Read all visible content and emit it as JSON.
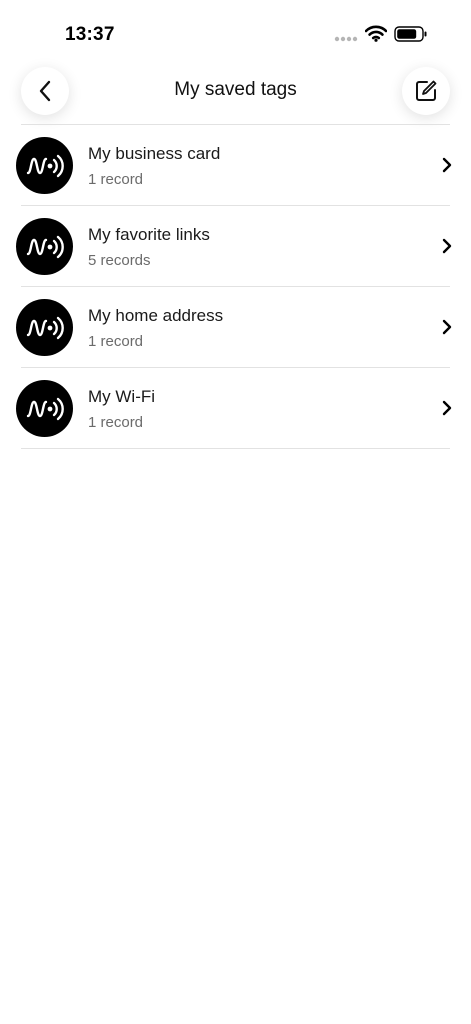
{
  "status_bar": {
    "time": "13:37",
    "icons": [
      "signal-dots-icon",
      "wifi-icon",
      "battery-icon"
    ]
  },
  "header": {
    "title": "My saved tags",
    "back_icon": "chevron-left-icon",
    "edit_icon": "compose-icon"
  },
  "tags": [
    {
      "title": "My business card",
      "count": "1 record"
    },
    {
      "title": "My favorite links",
      "count": "5 records"
    },
    {
      "title": "My home address",
      "count": "1 record"
    },
    {
      "title": "My Wi-Fi",
      "count": "1 record"
    }
  ],
  "colors": {
    "background": "#ffffff",
    "avatar": "#000000",
    "divider": "#e2e2e2",
    "secondary_text": "#6b6b6b"
  }
}
